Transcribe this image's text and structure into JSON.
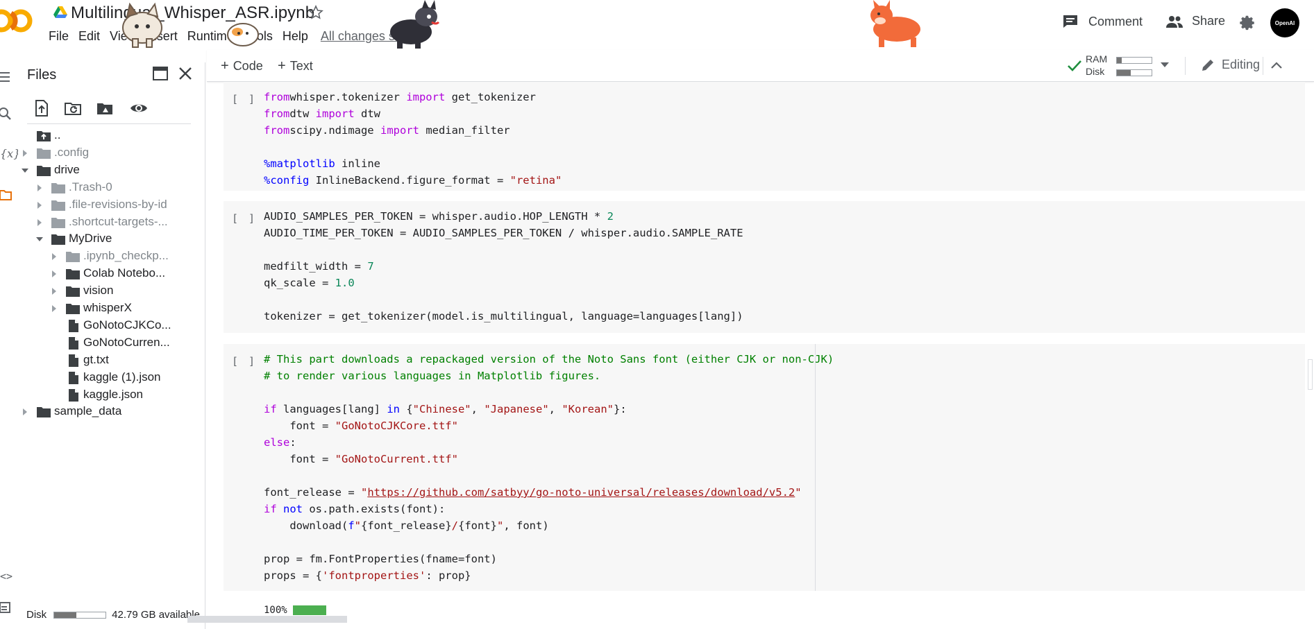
{
  "header": {
    "notebook_title": "Multilingual_Whisper_ASR.ipynb",
    "menu": [
      "File",
      "Edit",
      "View",
      "Insert",
      "Runtime",
      "Tools",
      "Help"
    ],
    "save_status": "All changes saved",
    "comment_label": "Comment",
    "share_label": "Share",
    "avatar_text": "OpenAI"
  },
  "toolbar": {
    "add_code_label": "Code",
    "add_text_label": "Text",
    "ram_label": "RAM",
    "disk_label": "Disk",
    "ram_usage": 0.14,
    "disk_usage": 0.4,
    "mode_label": "Editing"
  },
  "sidebar": {
    "title": "Files",
    "disk_label": "Disk",
    "disk_available": "42.79 GB available",
    "disk_usage": 0.43,
    "tree": [
      {
        "name": "..",
        "type": "up",
        "depth": 0,
        "expanded": null,
        "dim": false
      },
      {
        "name": ".config",
        "type": "folder",
        "depth": 0,
        "expanded": false,
        "dim": true
      },
      {
        "name": "drive",
        "type": "folder",
        "depth": 0,
        "expanded": true,
        "dim": false
      },
      {
        "name": ".Trash-0",
        "type": "folder",
        "depth": 1,
        "expanded": false,
        "dim": true
      },
      {
        "name": ".file-revisions-by-id",
        "type": "folder",
        "depth": 1,
        "expanded": false,
        "dim": true
      },
      {
        "name": ".shortcut-targets-...",
        "type": "folder",
        "depth": 1,
        "expanded": false,
        "dim": true
      },
      {
        "name": "MyDrive",
        "type": "folder",
        "depth": 1,
        "expanded": true,
        "dim": false
      },
      {
        "name": ".ipynb_checkp...",
        "type": "folder",
        "depth": 2,
        "expanded": false,
        "dim": true
      },
      {
        "name": "Colab Notebo...",
        "type": "folder",
        "depth": 2,
        "expanded": false,
        "dim": false
      },
      {
        "name": "vision",
        "type": "folder",
        "depth": 2,
        "expanded": false,
        "dim": false
      },
      {
        "name": "whisperX",
        "type": "folder",
        "depth": 2,
        "expanded": false,
        "dim": false
      },
      {
        "name": "GoNotoCJKCo...",
        "type": "file",
        "depth": 2,
        "expanded": null,
        "dim": false
      },
      {
        "name": "GoNotoCurren...",
        "type": "file",
        "depth": 2,
        "expanded": null,
        "dim": false
      },
      {
        "name": "gt.txt",
        "type": "file",
        "depth": 2,
        "expanded": null,
        "dim": false
      },
      {
        "name": "kaggle (1).json",
        "type": "file",
        "depth": 2,
        "expanded": null,
        "dim": false
      },
      {
        "name": "kaggle.json",
        "type": "file",
        "depth": 2,
        "expanded": null,
        "dim": false
      },
      {
        "name": "sample_data",
        "type": "folder",
        "depth": 0,
        "expanded": false,
        "dim": false
      }
    ]
  },
  "cells": [
    {
      "run_label": "[ ]",
      "lines": [
        [
          [
            "kw",
            "from"
          ],
          [
            "",
            "whisper.tokenizer "
          ],
          [
            "kw",
            "import"
          ],
          [
            "",
            " get_tokenizer"
          ]
        ],
        [
          [
            "kw",
            "from"
          ],
          [
            "",
            "dtw "
          ],
          [
            "kw",
            "import"
          ],
          [
            "",
            " dtw"
          ]
        ],
        [
          [
            "kw",
            "from"
          ],
          [
            "",
            "scipy.ndimage "
          ],
          [
            "kw",
            "import"
          ],
          [
            "",
            " median_filter"
          ]
        ],
        [],
        [
          [
            "mg",
            "%matplotlib"
          ],
          [
            "",
            " inline"
          ]
        ],
        [
          [
            "mg",
            "%config"
          ],
          [
            "",
            " InlineBackend.figure_format = "
          ],
          [
            "str",
            "\"retina\""
          ]
        ]
      ]
    },
    {
      "run_label": "[ ]",
      "lines": [
        [
          [
            "",
            "AUDIO_SAMPLES_PER_TOKEN = whisper.audio.HOP_LENGTH * "
          ],
          [
            "num",
            "2"
          ]
        ],
        [
          [
            "",
            "AUDIO_TIME_PER_TOKEN = AUDIO_SAMPLES_PER_TOKEN / whisper.audio.SAMPLE_RATE"
          ]
        ],
        [],
        [
          [
            "",
            "medfilt_width = "
          ],
          [
            "num",
            "7"
          ]
        ],
        [
          [
            "",
            "qk_scale = "
          ],
          [
            "num",
            "1.0"
          ]
        ],
        [],
        [
          [
            "",
            "tokenizer = get_tokenizer(model.is_multilingual, language=languages[lang])"
          ]
        ]
      ]
    },
    {
      "run_label": "[ ]",
      "lines": [
        [
          [
            "cm",
            "# This part downloads a repackaged version of the Noto Sans font (either CJK or non-CJK)"
          ]
        ],
        [
          [
            "cm",
            "# to render various languages in Matplotlib figures."
          ]
        ],
        [],
        [
          [
            "kw",
            "if"
          ],
          [
            "",
            " languages[lang] "
          ],
          [
            "kw2",
            "in"
          ],
          [
            "",
            " {"
          ],
          [
            "str",
            "\"Chinese\""
          ],
          [
            "",
            ", "
          ],
          [
            "str",
            "\"Japanese\""
          ],
          [
            "",
            ", "
          ],
          [
            "str",
            "\"Korean\""
          ],
          [
            "",
            "}:"
          ]
        ],
        [
          [
            "",
            "    font = "
          ],
          [
            "str",
            "\"GoNotoCJKCore.ttf\""
          ]
        ],
        [
          [
            "kw",
            "else"
          ],
          [
            "",
            ":"
          ]
        ],
        [
          [
            "",
            "    font = "
          ],
          [
            "str",
            "\"GoNotoCurrent.ttf\""
          ]
        ],
        [],
        [
          [
            "",
            "font_release = "
          ],
          [
            "str",
            "\""
          ],
          [
            "lnk",
            "https://github.com/satbyy/go-noto-universal/releases/download/v5.2"
          ],
          [
            "str",
            "\""
          ]
        ],
        [
          [
            "kw",
            "if"
          ],
          [
            "",
            " "
          ],
          [
            "kw2",
            "not"
          ],
          [
            "",
            " os.path.exists(font):"
          ]
        ],
        [
          [
            "",
            "    download("
          ],
          [
            "kw2",
            "f"
          ],
          [
            "str",
            "\""
          ],
          [
            "",
            "{font_release}"
          ],
          [
            "str",
            "/"
          ],
          [
            "",
            "{font}"
          ],
          [
            "str",
            "\""
          ],
          [
            "",
            ", font)"
          ]
        ],
        [],
        [
          [
            "",
            "prop = fm.FontProperties(fname=font)"
          ]
        ],
        [
          [
            "",
            "props = {"
          ],
          [
            "str",
            "'fontproperties'"
          ],
          [
            "",
            ": prop}"
          ]
        ]
      ]
    }
  ],
  "output": {
    "progress_text": "100%",
    "progress_value": 1.0
  },
  "colors": {
    "accent_green": "#1e8e3e",
    "keyword": "#af00db",
    "string": "#a31515",
    "number": "#098658",
    "comment": "#008000",
    "colab_orange": "#f9ab00"
  }
}
